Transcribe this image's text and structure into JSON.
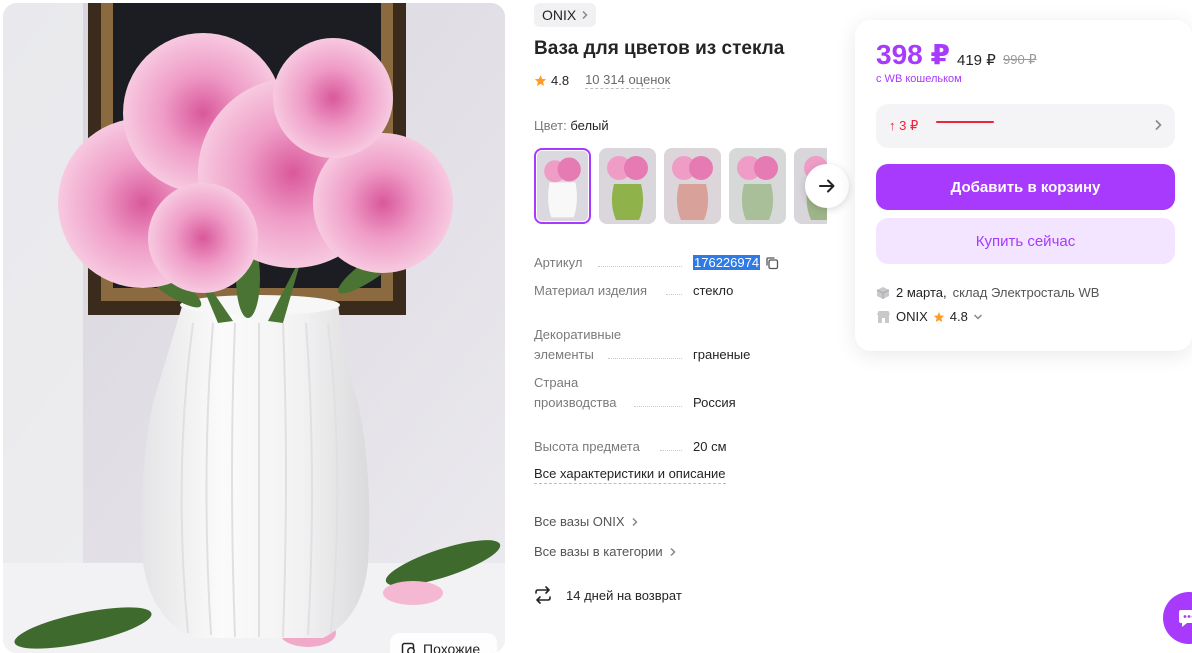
{
  "product": {
    "brand": "ONIX",
    "title": "Ваза для цветов из стекла",
    "rating": "4.8",
    "reviews": "10 314 оценок",
    "similar_label": "Похожие"
  },
  "color": {
    "label": "Цвет:",
    "value": "белый",
    "thumbs": [
      "white",
      "green",
      "pink",
      "clear",
      "partial"
    ]
  },
  "specs": {
    "sku_label": "Артикул",
    "sku_value": "176226974",
    "material_label": "Материал изделия",
    "material_value": "стекло",
    "decor_label_1": "Декоративные",
    "decor_label_2": "элементы",
    "decor_value": "граненые",
    "country_label_1": "Страна",
    "country_label_2": "производства",
    "country_value": "Россия",
    "height_label": "Высота предмета",
    "height_value": "20 см",
    "all_link": "Все характеристики и описание"
  },
  "links": {
    "brand_all": "Все вазы ONIX",
    "category_all": "Все вазы в категории"
  },
  "returns": "14 дней на возврат",
  "buy_card": {
    "price": "398 ₽",
    "price_mid": "419 ₽",
    "price_old": "990 ₽",
    "wallet_note": "с WB кошельком",
    "price_change": "↑ 3 ₽",
    "add_to_cart": "Добавить в корзину",
    "buy_now": "Купить сейчас",
    "delivery_date": "2 марта,",
    "delivery_where": "склад Электросталь WB",
    "seller_name": "ONIX",
    "seller_rating": "4.8"
  },
  "colors": {
    "accent": "#a73afd",
    "accent_light": "#f3e5ff",
    "price_up": "#f0213d",
    "star": "#ff9b26"
  }
}
